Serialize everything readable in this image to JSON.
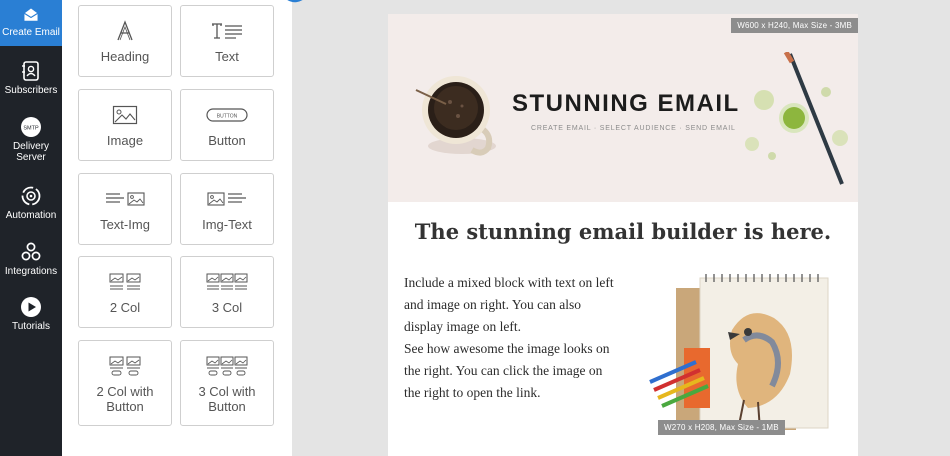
{
  "nav": {
    "items": [
      {
        "label": "Create Email",
        "icon": "envelope-icon"
      },
      {
        "label": "Subscribers",
        "icon": "address-book-icon"
      },
      {
        "label": "Delivery Server",
        "icon": "smtp-icon"
      },
      {
        "label": "Automation",
        "icon": "gear-cycle-icon"
      },
      {
        "label": "Integrations",
        "icon": "integrations-icon"
      },
      {
        "label": "Tutorials",
        "icon": "play-icon"
      }
    ],
    "smtp_text": "SMTP"
  },
  "blocks": [
    {
      "label": "Heading",
      "icon": "heading-icon"
    },
    {
      "label": "Text",
      "icon": "text-icon"
    },
    {
      "label": "Image",
      "icon": "image-icon"
    },
    {
      "label": "Button",
      "icon": "button-icon"
    },
    {
      "label": "Text-Img",
      "icon": "text-img-icon"
    },
    {
      "label": "Img-Text",
      "icon": "img-text-icon"
    },
    {
      "label": "2 Col",
      "icon": "two-col-icon"
    },
    {
      "label": "3 Col",
      "icon": "three-col-icon"
    },
    {
      "label": "2 Col with Button",
      "icon": "two-col-button-icon"
    },
    {
      "label": "3 Col with Button",
      "icon": "three-col-button-icon"
    }
  ],
  "button_icon_text": "BUTTON",
  "email": {
    "hero_badge": "W600 x H240, Max Size - 3MB",
    "hero_title": "STUNNING EMAIL",
    "hero_subtitle": "CREATE EMAIL  ·  SELECT AUDIENCE  ·  SEND EMAIL",
    "headline": "The stunning email builder is here.",
    "body_lines": [
      "Include a mixed block with text on left",
      "and image on right. You can also",
      "display image on left.",
      "See how awesome the image looks on",
      "the right. You can click the image on",
      "the right to open the link."
    ],
    "image_badge": "W270 x H208, Max Size - 1MB"
  },
  "colors": {
    "nav_bg": "#1f2329",
    "nav_active": "#2a7fd4",
    "hero_bg": "#f3ecea",
    "badge_bg": "#8d8d8d"
  }
}
